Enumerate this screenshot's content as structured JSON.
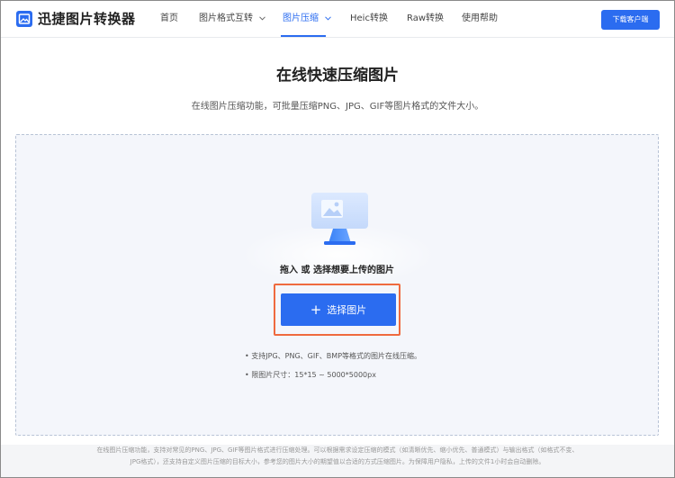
{
  "app": {
    "name": "迅捷图片转换器"
  },
  "nav": {
    "items": [
      {
        "label": "首页"
      },
      {
        "label": "图片格式互转"
      },
      {
        "label": "图片压缩"
      },
      {
        "label": "Heic转换"
      },
      {
        "label": "Raw转换"
      },
      {
        "label": "使用帮助"
      }
    ],
    "active": "图片压缩",
    "download_label": "下载客户端"
  },
  "main": {
    "title": "在线快速压缩图片",
    "subtitle": "在线图片压缩功能，可批量压缩PNG、JPG、GIF等图片格式的文件大小。",
    "upload": {
      "drop_text": "拖入 或 选择想要上传的图片",
      "button_label": "选择图片",
      "hints": [
        "• 支持JPG、PNG、GIF、BMP等格式的图片在线压缩。",
        "• 限图片尺寸：15*15 ~ 5000*5000px"
      ]
    }
  },
  "footer": {
    "note_line1": "在线图片压缩功能，支持对常见的PNG、JPG、GIF等图片格式进行压缩处理。可以根据需求设定压缩的模式（如清晰优先、缩小优先、普通模式）与输出格式（如格式不变、",
    "note_line2": "JPG格式），还支持自定义图片压缩的目标大小，参考您的图片大小的期望值以合适的方式压缩图片。为保障用户隐私，上传的文件1小时会自动删除。"
  },
  "colors": {
    "accent": "#2b6cf0",
    "highlight": "#ef6a3e"
  },
  "icons": {
    "logo": "image-convert-icon",
    "upload": "image-upload-illustration",
    "plus": "plus-icon",
    "chevron": "chevron-down-icon"
  }
}
